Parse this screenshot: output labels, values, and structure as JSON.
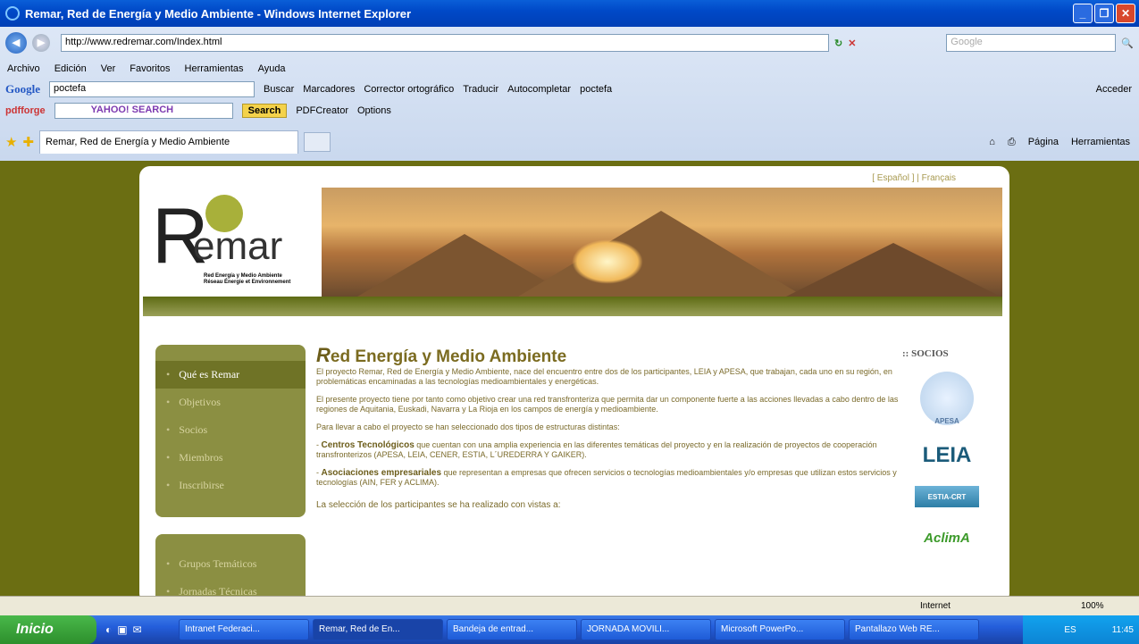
{
  "window": {
    "title": "Remar, Red de Energía y Medio Ambiente - Windows Internet Explorer"
  },
  "address": {
    "url": "http://www.redremar.com/Index.html",
    "search_placeholder": "Google"
  },
  "menu": [
    "Archivo",
    "Edición",
    "Ver",
    "Favoritos",
    "Herramientas",
    "Ayuda"
  ],
  "google_bar": {
    "query": "poctefa",
    "items": [
      "Buscar",
      "Marcadores",
      "Corrector ortográfico",
      "Traducir",
      "Autocompletar",
      "poctefa"
    ],
    "acceder": "Acceder"
  },
  "yahoo_bar": {
    "search_label": "YAHOO! SEARCH",
    "search_button": "Search",
    "pdf": "PDFCreator",
    "options": "Options"
  },
  "tabs": {
    "active": "Remar, Red de Energía y Medio Ambiente",
    "tools": [
      "Página",
      "Herramientas"
    ]
  },
  "site": {
    "lang": "[ Español ] | Français",
    "logo_word": "emar",
    "logo_letter": "R",
    "logo_sub1": "Red Energía y Medio Ambiente",
    "logo_sub2": "Réseau Énergie et Environnement",
    "nav1": [
      "Qué es Remar",
      "Objetivos",
      "Socios",
      "Miembros",
      "Inscribirse"
    ],
    "nav2": [
      "Grupos Temáticos",
      "Jornadas Técnicas"
    ],
    "heading_initial": "R",
    "heading_rest": "ed Energía y Medio Ambiente",
    "p1": "El proyecto Remar, Red de Energía y Medio Ambiente, nace del encuentro entre dos de los participantes, LEIA y APESA, que trabajan, cada uno en su región, en problemáticas encaminadas a las tecnologías medioambientales y energéticas.",
    "p2": "El presente proyecto tiene por tanto como objetivo crear una red transfronteriza que permita dar un componente fuerte a las acciones llevadas a cabo dentro de las regiones de Aquitania, Euskadi, Navarra y La Rioja en los campos de energía y medioambiente.",
    "p3": "Para llevar a cabo el proyecto se han seleccionado dos tipos de estructuras distintas:",
    "p4_strong": "Centros Tecnológicos",
    "p4": " que cuentan con una amplia experiencia en las diferentes temáticas del proyecto y en la realización de proyectos de cooperación transfronterizos (APESA, LEIA, CENER, ESTIA, L´UREDERRA Y GAIKER).",
    "p5_strong": "Asociaciones empresariales",
    "p5": " que representan a empresas que ofrecen servicios o tecnologías medioambientales y/o empresas que utilizan estos servicios y tecnologías (AIN, FER y ACLIMA).",
    "p6": "La selección de los participantes se ha realizado con vistas a:",
    "socios_title": ":: SOCIOS",
    "socios": [
      "APESA",
      "LEIA",
      "ESTIA-CRT",
      "AclimA"
    ]
  },
  "status": {
    "zone": "Internet",
    "zoom": "100%"
  },
  "taskbar": {
    "start": "Inicio",
    "items": [
      "Intranet Federaci...",
      "Remar, Red de En...",
      "Bandeja de entrad...",
      "JORNADA MOVILI...",
      "Microsoft PowerPo...",
      "Pantallazo Web RE..."
    ],
    "lang": "ES",
    "clock": "11:45"
  }
}
